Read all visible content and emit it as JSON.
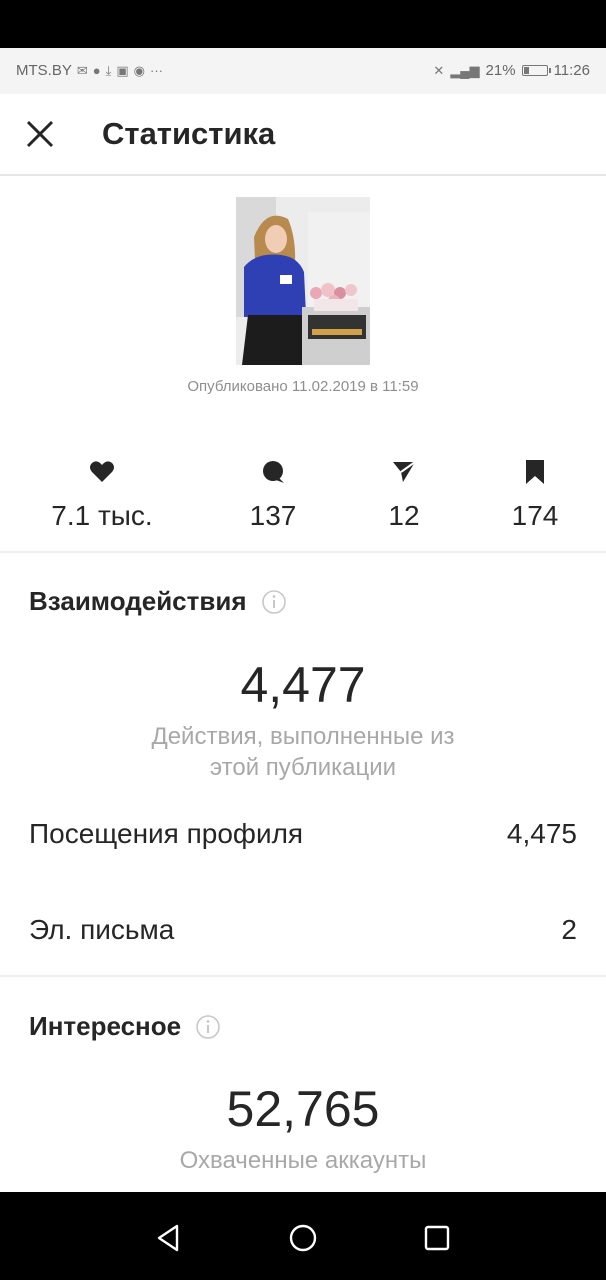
{
  "status_bar": {
    "carrier": "MTS.BY",
    "battery": "21%",
    "time": "11:26",
    "signal": "4G"
  },
  "header": {
    "title": "Статистика"
  },
  "post": {
    "published": "Опубликовано 11.02.2019 в 11:59"
  },
  "stats": {
    "likes": "7.1 тыс.",
    "comments": "137",
    "shares": "12",
    "saves": "174"
  },
  "interactions": {
    "title": "Взаимодействия",
    "total": "4,477",
    "subtitle_line1": "Действия, выполненные из",
    "subtitle_line2": "этой публикации",
    "rows": [
      {
        "label": "Посещения профиля",
        "value": "4,475"
      },
      {
        "label": "Эл. письма",
        "value": "2"
      }
    ]
  },
  "discovery": {
    "title": "Интересное",
    "total": "52,765",
    "subtitle_line1": "Охваченные аккаунты"
  },
  "colors": {
    "text": "#262626",
    "muted": "#8e8e8e",
    "divider": "#efefef"
  }
}
